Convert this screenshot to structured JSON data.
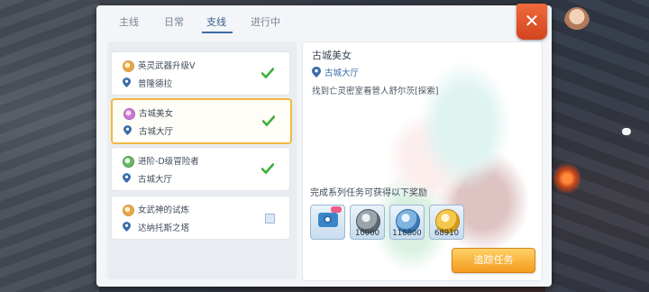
{
  "tabs": [
    {
      "label": "主线"
    },
    {
      "label": "日常"
    },
    {
      "label": "支线"
    },
    {
      "label": "进行中"
    }
  ],
  "active_tab": "支线",
  "quests": [
    {
      "title": "英灵武器升级Ⅴ",
      "location": "普隆德拉",
      "status": "completed",
      "icon": "quest-icon"
    },
    {
      "title": "古城美女",
      "location": "古城大厅",
      "status": "completed",
      "selected": true,
      "icon": "quest-icon"
    },
    {
      "title": "进阶-D级冒险者",
      "location": "古城大厅",
      "status": "completed",
      "icon": "quest-icon"
    },
    {
      "title": "女武神的试炼",
      "location": "达纳托斯之塔",
      "status": "incomplete",
      "icon": "quest-icon"
    }
  ],
  "detail": {
    "title": "古城美女",
    "location": "古城大厅",
    "description": "找到亡灵密室看管人舒尔茨[探索]",
    "reward_heading": "完成系列任务可获得以下奖励",
    "rewards": [
      {
        "icon": "camera-icon",
        "amount": ""
      },
      {
        "icon": "zeny-coin-icon",
        "amount": "10000"
      },
      {
        "icon": "base-exp-icon",
        "amount": "118800"
      },
      {
        "icon": "job-exp-icon",
        "amount": "68910"
      }
    ],
    "track_button": "追踪任务"
  },
  "close_label": "✕",
  "colors": {
    "accent_orange": "#f39a1e",
    "close_red": "#d2441f",
    "link_blue": "#3a6da8",
    "check_green": "#3fae3a"
  }
}
